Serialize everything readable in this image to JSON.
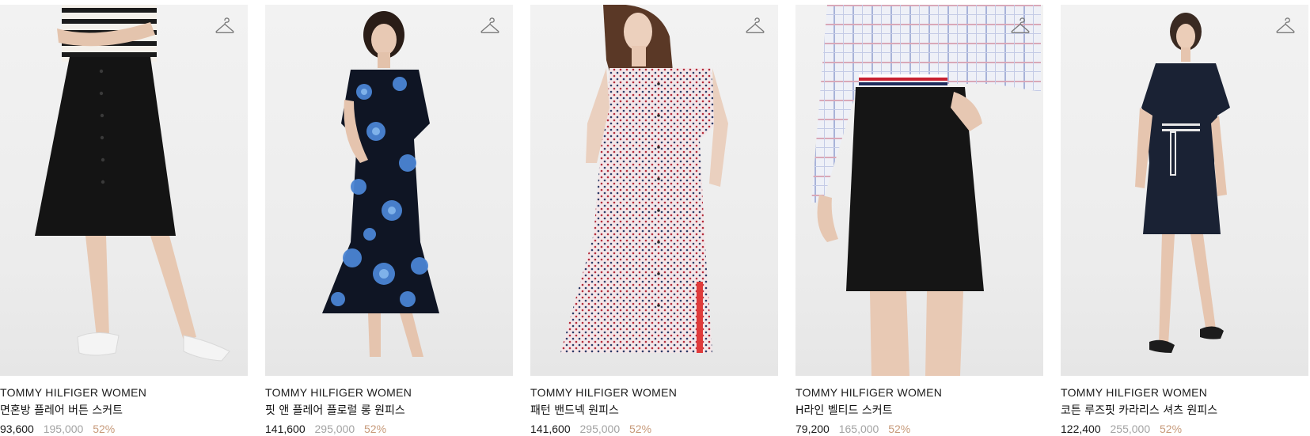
{
  "products": [
    {
      "brand": "TOMMY HILFIGER WOMEN",
      "name": "면혼방 플레어 버튼 스커트",
      "sale_price": "93,600",
      "original_price": "195,000",
      "discount": "52%",
      "icon": "hanger-icon"
    },
    {
      "brand": "TOMMY HILFIGER WOMEN",
      "name": "핏 앤 플레어 플로럴 롱 원피스",
      "sale_price": "141,600",
      "original_price": "295,000",
      "discount": "52%",
      "icon": "hanger-icon"
    },
    {
      "brand": "TOMMY HILFIGER WOMEN",
      "name": "패턴 밴드넥 원피스",
      "sale_price": "141,600",
      "original_price": "295,000",
      "discount": "52%",
      "icon": "hanger-icon"
    },
    {
      "brand": "TOMMY HILFIGER WOMEN",
      "name": "H라인 벨티드 스커트",
      "sale_price": "79,200",
      "original_price": "165,000",
      "discount": "52%",
      "icon": "hanger-icon"
    },
    {
      "brand": "TOMMY HILFIGER WOMEN",
      "name": "코튼 루즈핏 카라리스 셔츠 원피스",
      "sale_price": "122,400",
      "original_price": "255,000",
      "discount": "52%",
      "icon": "hanger-icon"
    }
  ],
  "colors": {
    "sale_price": "#1a1a1a",
    "original_price": "#a3a3a3",
    "discount": "#c79a7a"
  }
}
